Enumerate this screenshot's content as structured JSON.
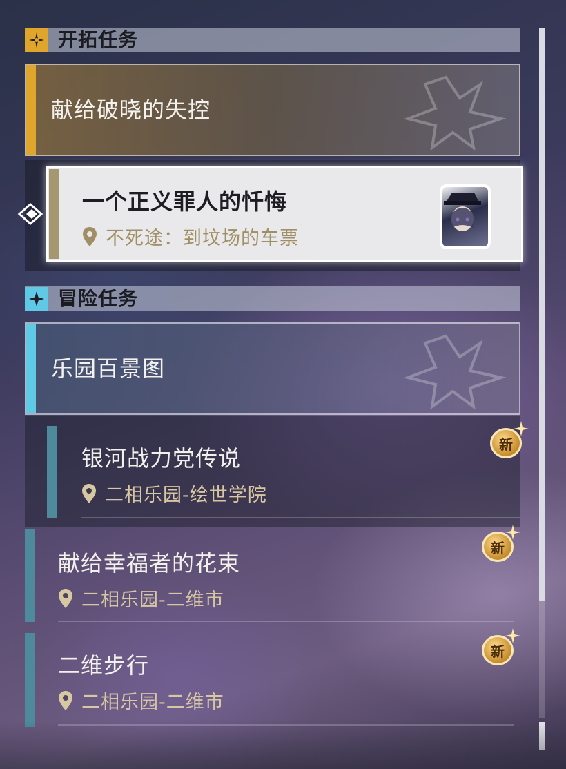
{
  "sections": {
    "trailblaze": {
      "title": "开拓任务",
      "accent": "#e0a52b"
    },
    "adventure": {
      "title": "冒险任务",
      "accent": "#5fc9e6"
    }
  },
  "trailblaze_mission": {
    "title": "献给破晓的失控",
    "active_quest": {
      "title": "一个正义罪人的忏悔",
      "location": "不死途：到坟场的车票"
    }
  },
  "adventure_mission": {
    "title": "乐园百景图",
    "quests": [
      {
        "title": "银河战力党传说",
        "location": "二相乐园-绘世学院",
        "badge": "新"
      },
      {
        "title": "献给幸福者的花束",
        "location": "二相乐园-二维市",
        "badge": "新"
      },
      {
        "title": "二维步行",
        "location": "二相乐园-二维市",
        "badge": "新"
      }
    ]
  },
  "colors": {
    "trailblaze_bar": "#e0a52b",
    "adventure_bar": "#5fc9e6",
    "quest_bar": "#4e8a9c",
    "location_text": "#d8c7a3"
  },
  "icons": [
    "trailblaze-star-icon",
    "adventure-star-icon",
    "selected-arrow-icon",
    "location-pin-icon",
    "new-badge-icon"
  ]
}
